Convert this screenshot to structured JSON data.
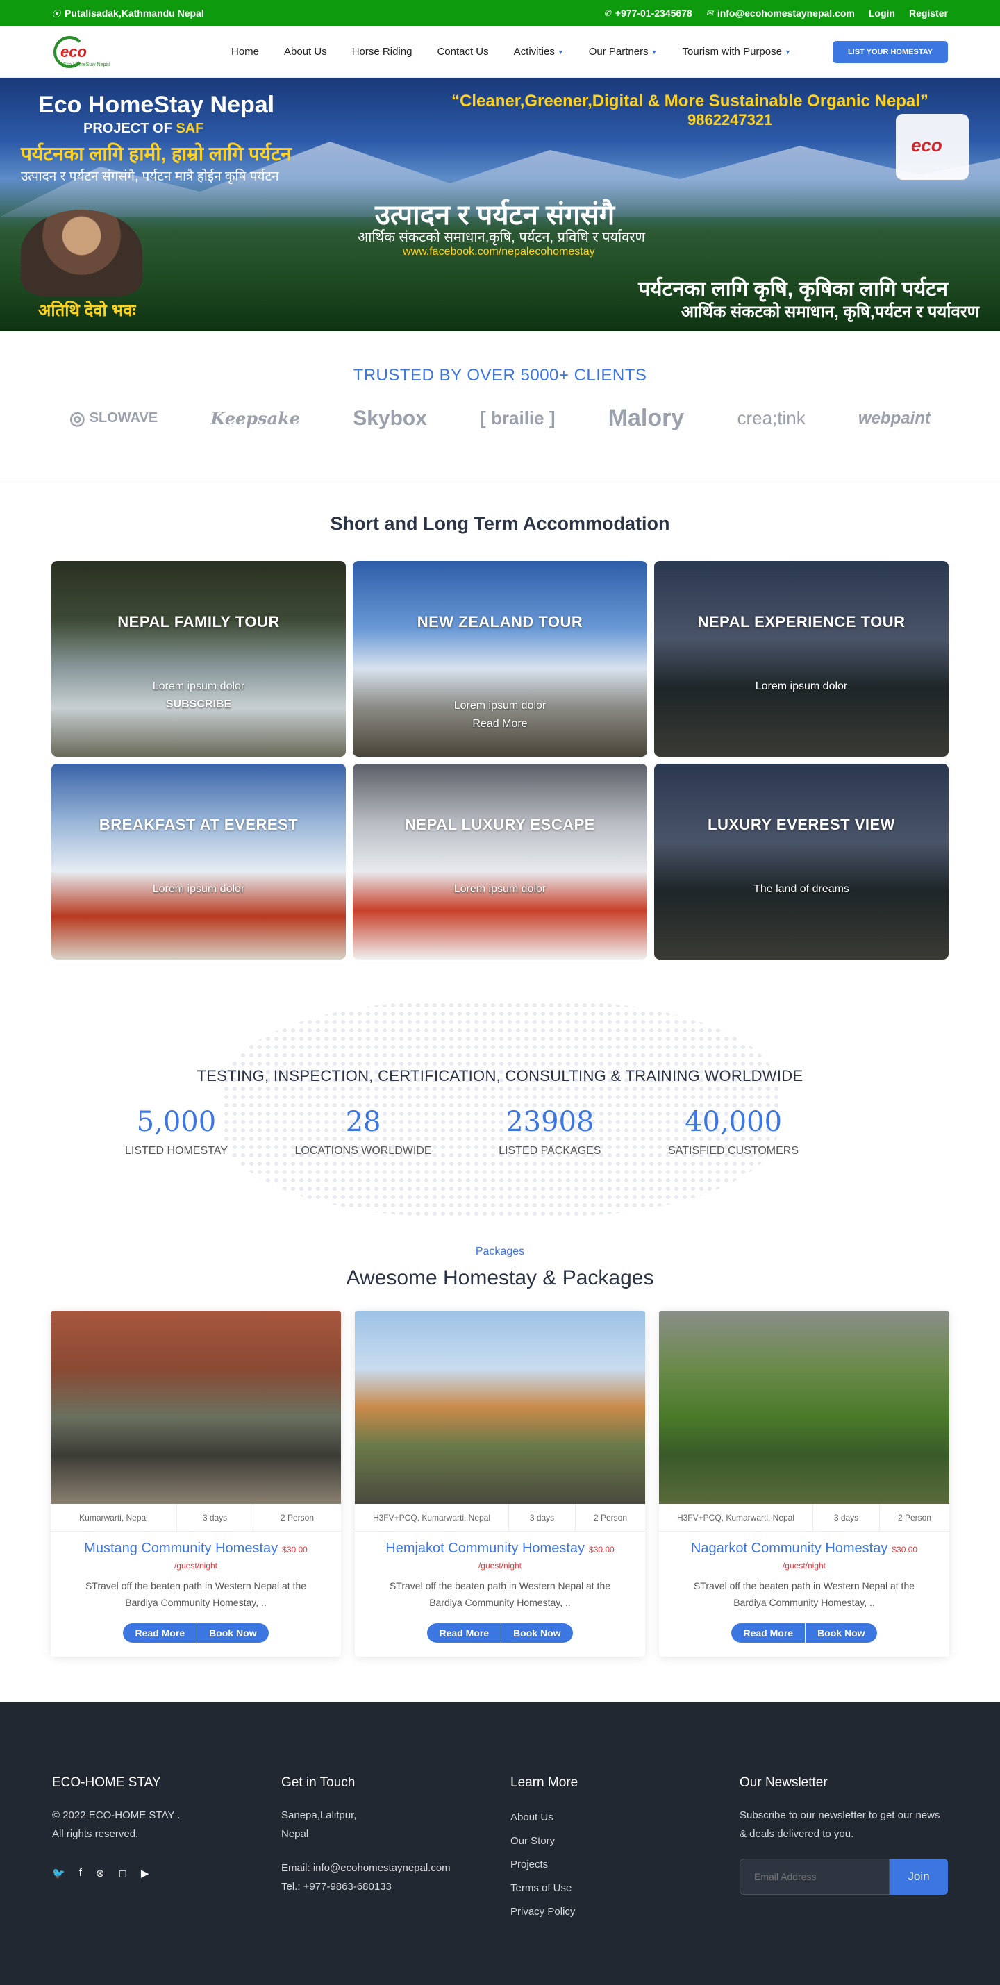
{
  "topbar": {
    "location": "Putalisadak,Kathmandu Nepal",
    "phone": "+977-01-2345678",
    "email": "info@ecohomestaynepal.com",
    "login": "Login",
    "register": "Register"
  },
  "nav": {
    "items": [
      "Home",
      "About Us",
      "Horse Riding",
      "Contact Us",
      "Activities",
      "Our Partners",
      "Tourism with Purpose"
    ],
    "cta": "LIST YOUR HOMESTAY",
    "logo_text": "eco"
  },
  "hero": {
    "title": "Eco HomeStay Nepal",
    "project": "PROJECT OF",
    "project_org": "SAF",
    "np_line1": "पर्यटनका लागि हामी, हाम्रो लागि पर्यटन",
    "np_line2": "उत्पादन र पर्यटन संगसंगै, पर्यटन मात्रै होईन कृषि पर्यटन",
    "quote": "“Cleaner,Greener,Digital & More Sustainable Organic Nepal”",
    "phone": "9862247321",
    "center_title": "उत्पादन र पर्यटन संगसंगै",
    "center_sub": "आर्थिक संकटको समाधान,कृषि, पर्यटन, प्रविधि र पर्यावरण",
    "facebook": "www.facebook.com/nepalecohomestay",
    "bottom_right1": "पर्यटनका लागि कृषि, कृषिका लागि पर्यटन",
    "bottom_right2": "आर्थिक संकटको समाधान, कृषि,पर्यटन र पर्यावरण",
    "bottom_left": "अतिथि देवो भवः"
  },
  "trusted": {
    "title": "TRUSTED BY OVER 5000+ CLIENTS",
    "brands": [
      "SLOWAVE",
      "Keepsake",
      "Skybox",
      "[ brailie ]",
      "Malory",
      "crea;tink",
      "webpaint"
    ]
  },
  "accommodation": {
    "title": "Short and Long Term Accommodation",
    "cards": [
      {
        "title": "NEPAL FAMILY TOUR",
        "sub": "Lorem ipsum dolor",
        "link": "SUBSCRIBE"
      },
      {
        "title": "NEW ZEALAND TOUR",
        "sub": "Lorem ipsum dolor",
        "link": "Read More"
      },
      {
        "title": "NEPAL EXPERIENCE TOUR",
        "sub": "Lorem ipsum dolor",
        "link": ""
      },
      {
        "title": "BREAKFAST AT EVEREST",
        "sub": "Lorem ipsum dolor",
        "link": ""
      },
      {
        "title": "NEPAL LUXURY ESCAPE",
        "sub": "Lorem ipsum dolor",
        "link": ""
      },
      {
        "title": "LUXURY EVEREST VIEW",
        "sub": "The land of dreams",
        "link": ""
      }
    ]
  },
  "stats": {
    "title": "TESTING, INSPECTION, CERTIFICATION, CONSULTING & TRAINING WORLDWIDE",
    "items": [
      {
        "value": "5,000",
        "label": "LISTED HOMESTAY"
      },
      {
        "value": "28",
        "label": "LOCATIONS WORLDWIDE"
      },
      {
        "value": "23908",
        "label": "LISTED PACKAGES"
      },
      {
        "value": "40,000",
        "label": "SATISFIED CUSTOMERS"
      }
    ]
  },
  "packages": {
    "subtitle": "Packages",
    "title": "Awesome Homestay & Packages",
    "items": [
      {
        "location": "Kumarwarti, Nepal",
        "days": "3 days",
        "persons": "2 Person",
        "name": "Mustang Community Homestay",
        "price": "$30.00",
        "per": "/guest/night",
        "desc": "STravel off the beaten path in Western Nepal at the Bardiya Community Homestay, ..",
        "read": "Read More",
        "book": "Book Now"
      },
      {
        "location": "H3FV+PCQ, Kumarwarti, Nepal",
        "days": "3 days",
        "persons": "2 Person",
        "name": "Hemjakot Community Homestay",
        "price": "$30.00",
        "per": "/guest/night",
        "desc": "STravel off the beaten path in Western Nepal at the Bardiya Community Homestay, ..",
        "read": "Read More",
        "book": "Book Now"
      },
      {
        "location": "H3FV+PCQ, Kumarwarti, Nepal",
        "days": "3 days",
        "persons": "2 Person",
        "name": "Nagarkot Community Homestay",
        "price": "$30.00",
        "per": "/guest/night",
        "desc": "STravel off the beaten path in Western Nepal at the Bardiya Community Homestay, ..",
        "read": "Read More",
        "book": "Book Now"
      }
    ]
  },
  "footer": {
    "brand": "ECO-HOME STAY",
    "copy1": "© 2022 ECO-HOME STAY .",
    "copy2": "All rights reserved.",
    "contact_title": "Get in Touch",
    "address1": "Sanepa,Lalitpur,",
    "address2": "Nepal",
    "email": "Email: info@ecohomestaynepal.com",
    "tel": "Tel.: +977-9863-680133",
    "learn_title": "Learn More",
    "links": [
      "About Us",
      "Our Story",
      "Projects",
      "Terms of Use",
      "Privacy Policy"
    ],
    "newsletter_title": "Our Newsletter",
    "newsletter_text": "Subscribe to our newsletter to get our news & deals delivered to you.",
    "email_placeholder": "Email Address",
    "join": "Join"
  },
  "colors": {
    "green": "#0d9b0d",
    "accent": "#3c76e1",
    "footer": "#222831",
    "price": "#e0383e"
  }
}
